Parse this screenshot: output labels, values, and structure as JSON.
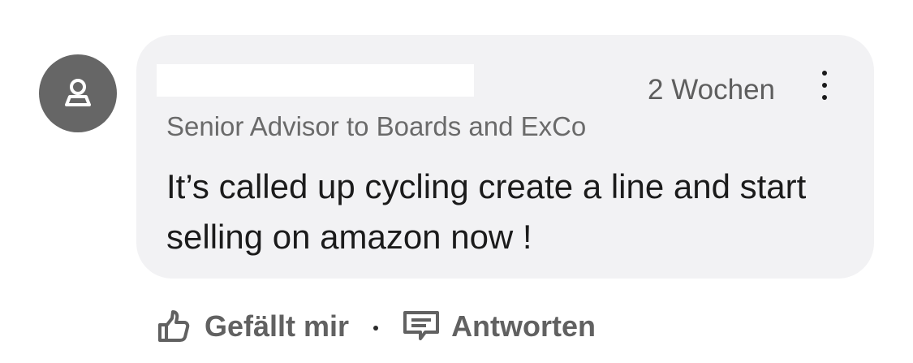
{
  "comment": {
    "timestamp": "2 Wochen",
    "headline": "Senior Advisor to Boards and ExCo",
    "text": "It’s called up cycling create a line and start selling on amazon now !",
    "avatar_icon": "person-placeholder-icon",
    "more_icon": "more-vertical-icon"
  },
  "actions": {
    "like_label": "Gefällt mir",
    "like_icon": "thumbs-up-icon",
    "separator": "·",
    "reply_label": "Antworten",
    "reply_icon": "speech-bubble-icon"
  },
  "colors": {
    "bubble_background": "#f2f2f4",
    "avatar_background": "#666666",
    "text_primary": "#1b1b1b",
    "text_secondary": "#5e5e5e"
  }
}
